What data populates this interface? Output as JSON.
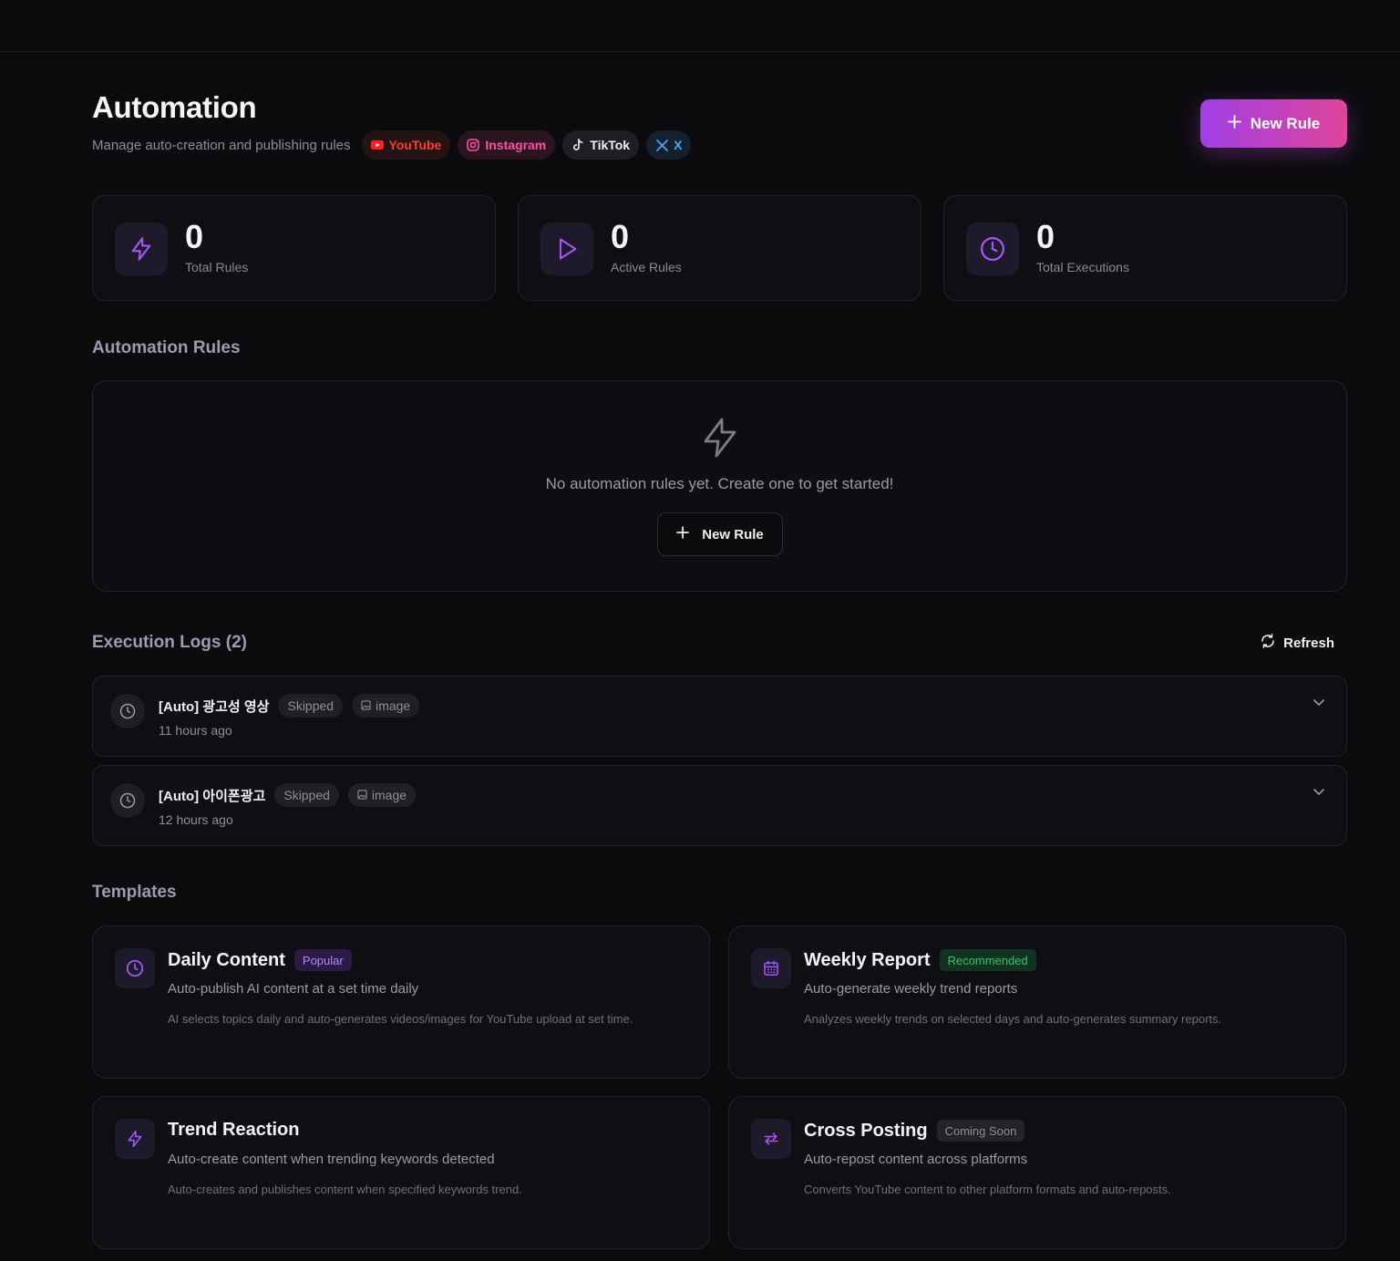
{
  "header": {
    "title": "Automation",
    "subtitle": "Manage auto-creation and publishing rules",
    "platforms": [
      {
        "label": "YouTube",
        "icon": "youtube-icon",
        "color": "#ff3b30"
      },
      {
        "label": "Instagram",
        "icon": "instagram-icon",
        "color": "#ff4fa3"
      },
      {
        "label": "TikTok",
        "icon": "tiktok-icon",
        "color": "#f2f2f5"
      },
      {
        "label": "X",
        "icon": "x-icon",
        "color": "#4aa8ff"
      }
    ],
    "new_rule_label": "New Rule"
  },
  "stats": [
    {
      "value": "0",
      "label": "Total Rules",
      "icon": "lightning-icon"
    },
    {
      "value": "0",
      "label": "Active Rules",
      "icon": "play-icon"
    },
    {
      "value": "0",
      "label": "Total Executions",
      "icon": "clock-icon"
    }
  ],
  "rules": {
    "title": "Automation Rules",
    "empty_text": "No automation rules yet. Create one to get started!",
    "new_rule_label": "New Rule"
  },
  "logs": {
    "title": "Execution Logs (2)",
    "refresh_label": "Refresh",
    "items": [
      {
        "title": "[Auto] 광고성 영상",
        "status": "Skipped",
        "type": "image",
        "time": "11 hours ago"
      },
      {
        "title": "[Auto] 아이폰광고",
        "status": "Skipped",
        "type": "image",
        "time": "12 hours ago"
      }
    ]
  },
  "templates": {
    "title": "Templates",
    "items": [
      {
        "title": "Daily Content",
        "badge": "Popular",
        "description": "Auto-publish AI content at a set time daily",
        "detail": "AI selects topics daily and auto-generates videos/images for YouTube upload at set time.",
        "icon": "clock-icon"
      },
      {
        "title": "Weekly Report",
        "badge": "Recommended",
        "description": "Auto-generate weekly trend reports",
        "detail": "Analyzes weekly trends on selected days and auto-generates summary reports.",
        "icon": "calendar-icon"
      },
      {
        "title": "Trend Reaction",
        "badge": "",
        "description": "Auto-create content when trending keywords detected",
        "detail": "Auto-creates and publishes content when specified keywords trend.",
        "icon": "lightning-icon"
      },
      {
        "title": "Cross Posting",
        "badge": "Coming Soon",
        "description": "Auto-repost content across platforms",
        "detail": "Converts YouTube content to other platform formats and auto-reposts.",
        "icon": "repost-icon"
      }
    ]
  },
  "colors": {
    "accent": "#a855f7",
    "gradient_start": "#a13fe6",
    "gradient_end": "#e0449a",
    "background": "#0b0b0e"
  }
}
